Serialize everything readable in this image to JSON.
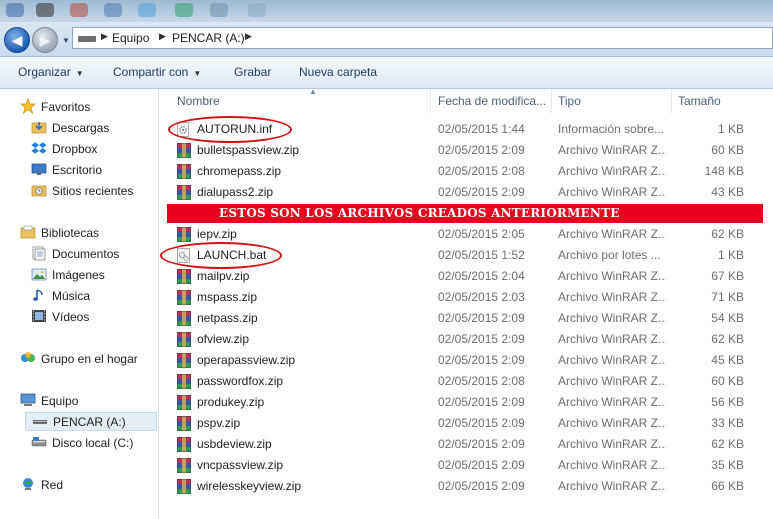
{
  "address": {
    "items": [
      "Equipo",
      "PENCAR (A:)"
    ],
    "separator": "▶"
  },
  "toolbar": {
    "organize": "Organizar",
    "share": "Compartir con",
    "burn": "Grabar",
    "new_folder": "Nueva carpeta"
  },
  "sidebar": {
    "favorites": "Favoritos",
    "downloads": "Descargas",
    "dropbox": "Dropbox",
    "desktop": "Escritorio",
    "recent": "Sitios recientes",
    "libraries": "Bibliotecas",
    "documents": "Documentos",
    "images": "Imágenes",
    "music": "Música",
    "videos": "Vídeos",
    "homegroup": "Grupo en el hogar",
    "computer": "Equipo",
    "pencar": "PENCAR (A:)",
    "local_disk": "Disco local (C:)",
    "network": "Red"
  },
  "columns": {
    "name": "Nombre",
    "date": "Fecha de modifica...",
    "type": "Tipo",
    "size": "Tamaño"
  },
  "banner": "ESTOS SON LOS ARCHIVOS CREADOS ANTERIORMENTE",
  "files": [
    {
      "name": "AUTORUN.inf",
      "date": "02/05/2015 1:44",
      "type": "Información sobre...",
      "size": "1 KB",
      "icon": "settings-file-icon"
    },
    {
      "name": "bulletspassview.zip",
      "date": "02/05/2015 2:09",
      "type": "Archivo WinRAR Z...",
      "size": "60 KB",
      "icon": "winrar-zip-icon"
    },
    {
      "name": "chromepass.zip",
      "date": "02/05/2015 2:08",
      "type": "Archivo WinRAR Z...",
      "size": "148 KB",
      "icon": "winrar-zip-icon"
    },
    {
      "name": "dialupass2.zip",
      "date": "02/05/2015 2:09",
      "type": "Archivo WinRAR Z...",
      "size": "43 KB",
      "icon": "winrar-zip-icon"
    },
    {
      "name": "iepv.zip",
      "date": "02/05/2015 2:05",
      "type": "Archivo WinRAR Z...",
      "size": "62 KB",
      "icon": "winrar-zip-icon"
    },
    {
      "name": "LAUNCH.bat",
      "date": "02/05/2015 1:52",
      "type": "Archivo por lotes ...",
      "size": "1 KB",
      "icon": "batch-file-icon"
    },
    {
      "name": "mailpv.zip",
      "date": "02/05/2015 2:04",
      "type": "Archivo WinRAR Z...",
      "size": "67 KB",
      "icon": "winrar-zip-icon"
    },
    {
      "name": "mspass.zip",
      "date": "02/05/2015 2:03",
      "type": "Archivo WinRAR Z...",
      "size": "71 KB",
      "icon": "winrar-zip-icon"
    },
    {
      "name": "netpass.zip",
      "date": "02/05/2015 2:09",
      "type": "Archivo WinRAR Z...",
      "size": "54 KB",
      "icon": "winrar-zip-icon"
    },
    {
      "name": "ofview.zip",
      "date": "02/05/2015 2:09",
      "type": "Archivo WinRAR Z...",
      "size": "62 KB",
      "icon": "winrar-zip-icon"
    },
    {
      "name": "operapassview.zip",
      "date": "02/05/2015 2:09",
      "type": "Archivo WinRAR Z...",
      "size": "45 KB",
      "icon": "winrar-zip-icon"
    },
    {
      "name": "passwordfox.zip",
      "date": "02/05/2015 2:08",
      "type": "Archivo WinRAR Z...",
      "size": "60 KB",
      "icon": "winrar-zip-icon"
    },
    {
      "name": "produkey.zip",
      "date": "02/05/2015 2:09",
      "type": "Archivo WinRAR Z...",
      "size": "56 KB",
      "icon": "winrar-zip-icon"
    },
    {
      "name": "pspv.zip",
      "date": "02/05/2015 2:09",
      "type": "Archivo WinRAR Z...",
      "size": "33 KB",
      "icon": "winrar-zip-icon"
    },
    {
      "name": "usbdeview.zip",
      "date": "02/05/2015 2:09",
      "type": "Archivo WinRAR Z...",
      "size": "62 KB",
      "icon": "winrar-zip-icon"
    },
    {
      "name": "vncpassview.zip",
      "date": "02/05/2015 2:09",
      "type": "Archivo WinRAR Z...",
      "size": "35 KB",
      "icon": "winrar-zip-icon"
    },
    {
      "name": "wirelesskeyview.zip",
      "date": "02/05/2015 2:09",
      "type": "Archivo WinRAR Z...",
      "size": "66 KB",
      "icon": "winrar-zip-icon"
    }
  ],
  "colors": {
    "annotation_red": "#e8001e",
    "accent_blue": "#1c5db3"
  }
}
